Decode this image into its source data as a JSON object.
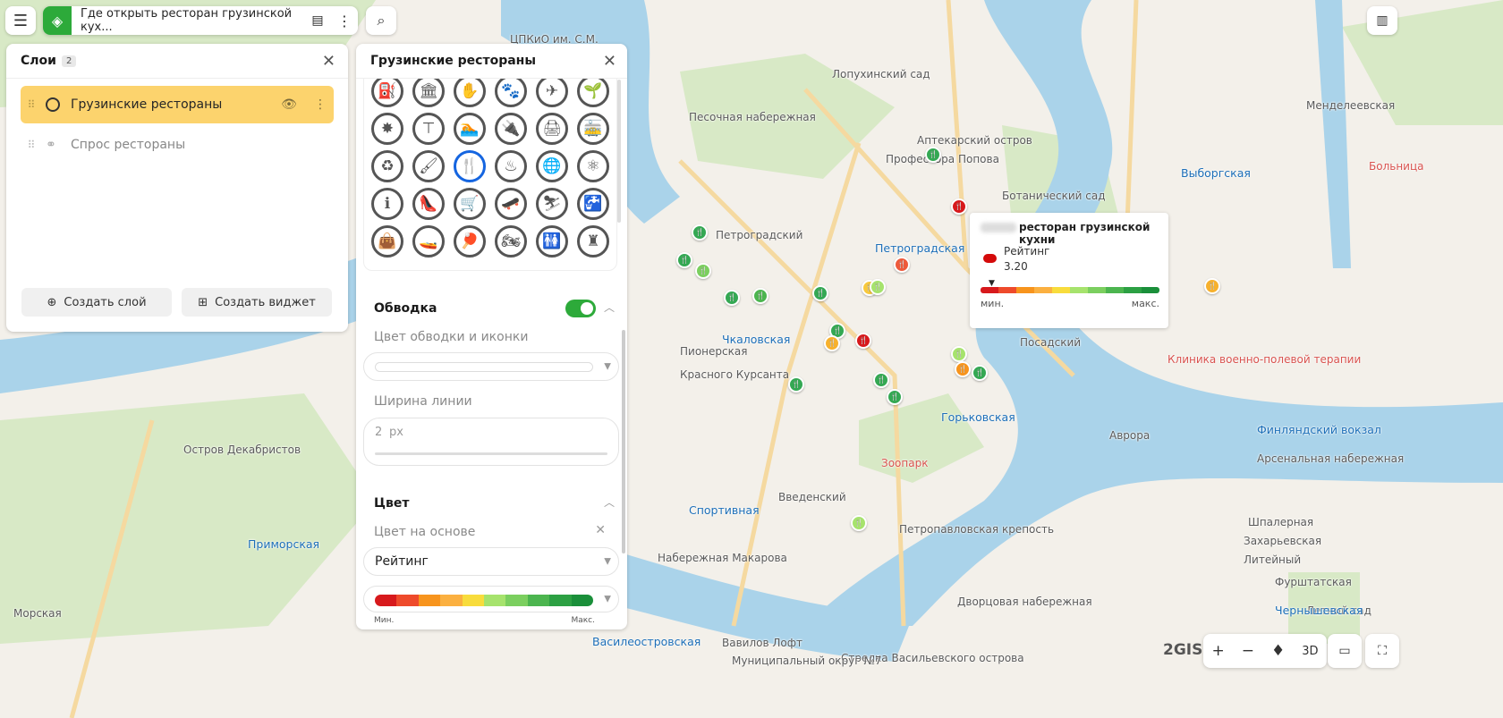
{
  "toolbar": {
    "project_title": "Где открыть ресторан грузинской кух...",
    "menu_icon": "hamburger-icon",
    "layers_icon": "layers-icon",
    "chart_icon": "chart-icon",
    "more_icon": "more-vertical-icon",
    "search_icon": "search-icon"
  },
  "layers_panel": {
    "title": "Слои",
    "count": "2",
    "items": [
      {
        "label": "Грузинские рестораны",
        "active": true
      },
      {
        "label": "Спрос рестораны",
        "active": false
      }
    ],
    "create_layer": "Создать слой",
    "create_widget": "Создать виджет"
  },
  "style_panel": {
    "title": "Грузинские рестораны",
    "icons": [
      "oil-pump",
      "museum",
      "hand-card",
      "paw",
      "airplane",
      "plant",
      "burst",
      "signpost",
      "swimming",
      "plug",
      "printer",
      "tram",
      "recycle",
      "paint-roller",
      "fork-knife",
      "hot-food",
      "globe",
      "atom",
      "info-figure",
      "high-heel",
      "cart",
      "skateboard",
      "skiing",
      "plumbing",
      "bag",
      "boat",
      "ping-pong",
      "motorcycle",
      "toilets",
      "chess-rook"
    ],
    "icon_glyphs": [
      "⛽",
      "🏛",
      "✋",
      "🐾",
      "✈",
      "🌱",
      "✸",
      "⊤",
      "🏊",
      "🔌",
      "🖨",
      "🚋",
      "♻",
      "🖌",
      "🍴",
      "♨",
      "🌐",
      "⚛",
      "ℹ",
      "👠",
      "🛒",
      "🛹",
      "⛷",
      "🚰",
      "👜",
      "🚤",
      "🏓",
      "🏍",
      "🚻",
      "♜"
    ],
    "selected_icon": "fork-knife",
    "outline": {
      "title": "Обводка",
      "enabled": true,
      "color_label": "Цвет обводки и иконки",
      "width_label": "Ширина линии",
      "width_value": "2",
      "width_unit": "px"
    },
    "color": {
      "title": "Цвет",
      "based_on_label": "Цвет на основе",
      "based_on_value": "Рейтинг",
      "min_label": "Мин.",
      "max_label": "Макс."
    }
  },
  "ramp_colors": [
    "#d7191c",
    "#ee4a2b",
    "#f7941d",
    "#fbb040",
    "#f8dc3c",
    "#a6e36d",
    "#7bcf5f",
    "#4cb54f",
    "#2ca043",
    "#1a8f3a"
  ],
  "accent": "#2daa3a",
  "tooltip": {
    "title": "ресторан грузинской кухни",
    "field": "Рейтинг",
    "value": "3.20",
    "min": "мин.",
    "max": "макс.",
    "color": "#d40a0a"
  },
  "map_controls": {
    "logo": "2GIS",
    "zoom_in": "+",
    "zoom_out": "−",
    "three_d": "3D"
  },
  "map_labels": [
    {
      "t": "ЦПКиО им. С.М.",
      "c": "lbl"
    },
    {
      "t": "Лопухинский сад",
      "c": "lbl"
    },
    {
      "t": "Песочная набережная",
      "c": "lbl"
    },
    {
      "t": "Аптекарский остров",
      "c": "lbl"
    },
    {
      "t": "Профессора Попова",
      "c": "lbl"
    },
    {
      "t": "Ботанический сад",
      "c": "lbl"
    },
    {
      "t": "Петроградский",
      "c": "lbl"
    },
    {
      "t": "Петроградская",
      "c": "lbl metro"
    },
    {
      "t": "Выборгская",
      "c": "lbl metro"
    },
    {
      "t": "Больница",
      "c": "lbl red"
    },
    {
      "t": "Менделеевская",
      "c": "lbl"
    },
    {
      "t": "Чкаловская",
      "c": "lbl metro"
    },
    {
      "t": "Пионерская",
      "c": "lbl"
    },
    {
      "t": "Красного Курсанта",
      "c": "lbl"
    },
    {
      "t": "Посадский",
      "c": "lbl"
    },
    {
      "t": "Клиника военно-полевой терапии",
      "c": "lbl red"
    },
    {
      "t": "Горьковская",
      "c": "lbl metro"
    },
    {
      "t": "Аврора",
      "c": "lbl"
    },
    {
      "t": "Финляндский вокзал",
      "c": "lbl metro"
    },
    {
      "t": "Арсенальная набережная",
      "c": "lbl"
    },
    {
      "t": "Зоопарк",
      "c": "lbl red"
    },
    {
      "t": "Введенский",
      "c": "lbl"
    },
    {
      "t": "Спортивная",
      "c": "lbl metro"
    },
    {
      "t": "Петропавловская крепость",
      "c": "lbl"
    },
    {
      "t": "Шпалерная",
      "c": "lbl"
    },
    {
      "t": "Захарьевская",
      "c": "lbl"
    },
    {
      "t": "Литейный",
      "c": "lbl"
    },
    {
      "t": "Приморская",
      "c": "lbl metro"
    },
    {
      "t": "Остров Декабристов",
      "c": "lbl"
    },
    {
      "t": "Морская",
      "c": "lbl"
    },
    {
      "t": "Набережная Макарова",
      "c": "lbl"
    },
    {
      "t": "Стрелка Васильевского острова",
      "c": "lbl"
    },
    {
      "t": "Дворцовая набережная",
      "c": "lbl"
    },
    {
      "t": "Летний сад",
      "c": "lbl"
    },
    {
      "t": "Фурштатская",
      "c": "lbl"
    },
    {
      "t": "Чернышевская",
      "c": "lbl metro"
    },
    {
      "t": "Василеостровская",
      "c": "lbl metro"
    },
    {
      "t": "Вавилов Лофт",
      "c": "lbl"
    },
    {
      "t": "Муниципальный округ №7",
      "c": "lbl"
    }
  ],
  "markers": [
    "#34a853",
    "#34a853",
    "#7bcf5f",
    "#34a853",
    "#4cb54f",
    "#34a853",
    "#f8c93c",
    "#a6e36d",
    "#34a853",
    "#f7b12d",
    "#d7191c",
    "#d7191c",
    "#ee5a3b",
    "#34a853",
    "#a6e36d",
    "#34a853",
    "#f7941d",
    "#34a853",
    "#34a853",
    "#34a853",
    "#a6e36d",
    "#f7b12d"
  ]
}
